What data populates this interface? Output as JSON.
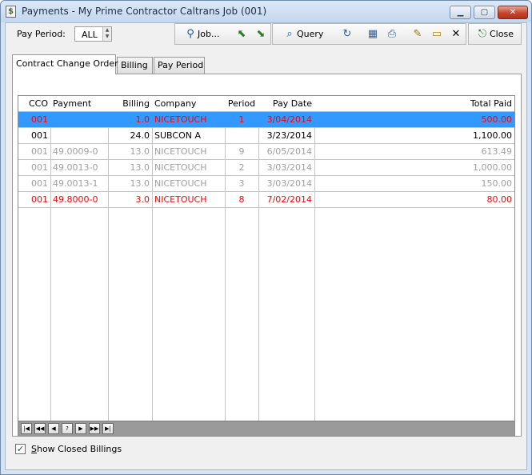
{
  "window": {
    "title": "Payments - My Prime Contractor Caltrans Job (001)",
    "minimize": "▁",
    "maximize": "▢",
    "close": "✕"
  },
  "toolbar": {
    "pay_period_label": "Pay Period:",
    "pay_period_value": "ALL",
    "job_label": "Job...",
    "query_label": "Query",
    "close_label": "Close"
  },
  "tabs": [
    {
      "label": "Contract Change Order",
      "active": true
    },
    {
      "label": "Billing",
      "active": false
    },
    {
      "label": "Pay Period",
      "active": false
    }
  ],
  "grid": {
    "columns": {
      "cco": "CCO",
      "payment": "Payment",
      "billing": "Billing",
      "company": "Company",
      "period": "Period",
      "pay_date": "Pay Date",
      "total_paid": "Total Paid"
    },
    "rows": [
      {
        "cco": "001",
        "payment": "",
        "billing": "1.0",
        "company": "NICETOUCH",
        "period": "1",
        "pay_date": "3/04/2014",
        "total_paid": "500.00",
        "style": "selected"
      },
      {
        "cco": "001",
        "payment": "",
        "billing": "24.0",
        "company": "SUBCON A",
        "period": "",
        "pay_date": "3/23/2014",
        "total_paid": "1,100.00",
        "style": "normal"
      },
      {
        "cco": "001",
        "payment": "49.0009-0",
        "billing": "13.0",
        "company": "NICETOUCH",
        "period": "9",
        "pay_date": "6/05/2014",
        "total_paid": "613.49",
        "style": "closed"
      },
      {
        "cco": "001",
        "payment": "49.0013-0",
        "billing": "13.0",
        "company": "NICETOUCH",
        "period": "2",
        "pay_date": "3/03/2014",
        "total_paid": "1,000.00",
        "style": "closed"
      },
      {
        "cco": "001",
        "payment": "49.0013-1",
        "billing": "13.0",
        "company": "NICETOUCH",
        "period": "3",
        "pay_date": "3/03/2014",
        "total_paid": "150.00",
        "style": "closed"
      },
      {
        "cco": "001",
        "payment": "49.8000-0",
        "billing": "3.0",
        "company": "NICETOUCH",
        "period": "8",
        "pay_date": "7/02/2014",
        "total_paid": "80.00",
        "style": "red"
      }
    ],
    "navigator": [
      "|◀",
      "◀◀",
      "◀",
      "?",
      "▶",
      "▶▶",
      "▶|"
    ]
  },
  "show_closed": {
    "label_accel": "S",
    "label_rest": "how Closed Billings",
    "checked": true
  },
  "colors": {
    "selected_bg": "#3399ff",
    "selected_text": "#ff0000",
    "closed_text": "#a0a0a0",
    "red_text": "#ff0000"
  }
}
